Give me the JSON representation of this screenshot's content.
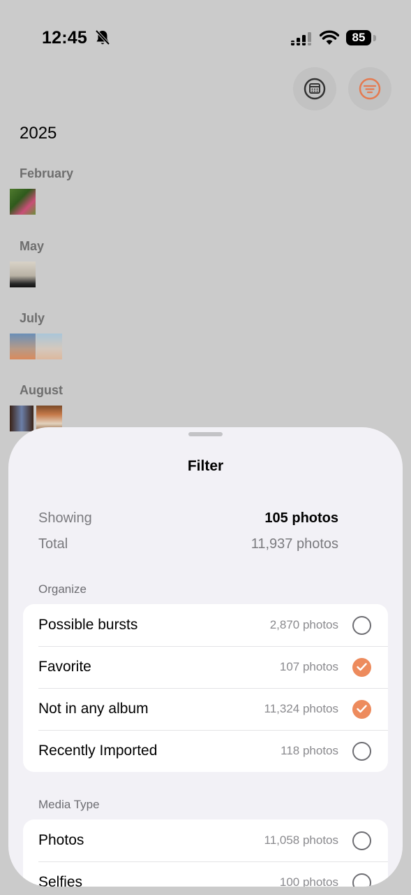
{
  "status_bar": {
    "time": "12:45",
    "battery": "85"
  },
  "toolbar": {
    "calendar_icon": "calendar-icon",
    "filter_icon": "filter-icon",
    "accent": "#e57a50"
  },
  "library": {
    "year": "2025",
    "months": [
      "February",
      "May",
      "July",
      "August"
    ]
  },
  "sheet": {
    "title": "Filter",
    "summary": {
      "showing_label": "Showing",
      "showing_value": "105 photos",
      "total_label": "Total",
      "total_value": "11,937 photos"
    },
    "organize": {
      "header": "Organize",
      "items": [
        {
          "label": "Possible bursts",
          "count": "2,870 photos",
          "checked": false
        },
        {
          "label": "Favorite",
          "count": "107 photos",
          "checked": true
        },
        {
          "label": "Not in any album",
          "count": "11,324 photos",
          "checked": true
        },
        {
          "label": "Recently Imported",
          "count": "118 photos",
          "checked": false
        }
      ]
    },
    "media_type": {
      "header": "Media Type",
      "items": [
        {
          "label": "Photos",
          "count": "11,058 photos",
          "checked": false
        },
        {
          "label": "Selfies",
          "count": "100 photos",
          "checked": false
        }
      ]
    },
    "check_color": "#ed8b5d"
  }
}
